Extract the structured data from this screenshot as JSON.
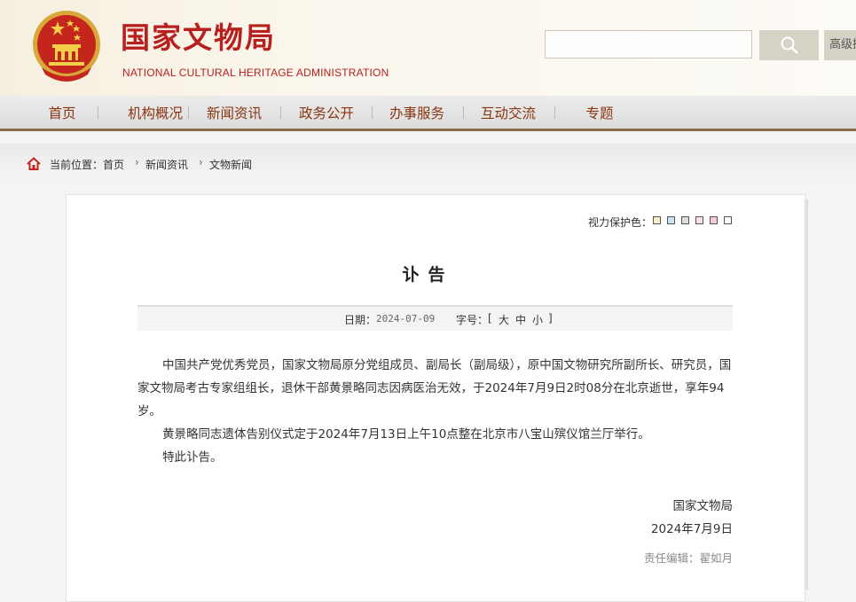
{
  "header": {
    "title": "国家文物局",
    "subtitle": "NATIONAL CULTURAL HERITAGE ADMINISTRATION",
    "search_placeholder": "",
    "advanced_label": "高级搜"
  },
  "nav": {
    "items": [
      "首页",
      "机构概况",
      "新闻资讯",
      "政务公开",
      "办事服务",
      "互动交流",
      "专题"
    ]
  },
  "breadcrumb": {
    "prefix": "当前位置：",
    "items": [
      "首页",
      "新闻资讯",
      "文物新闻"
    ]
  },
  "eye_protection": {
    "label": "视力保护色：",
    "colors": [
      "#f9f0c2",
      "#c5e6f1",
      "#dcdcdc",
      "#f8e2e2",
      "#f6c9d0",
      "#ffffff"
    ]
  },
  "article": {
    "title": "讣告",
    "date_label": "日期：",
    "date": "2024-07-09",
    "fontsize_label": "字号：",
    "fontsize_open": "[",
    "fontsize_large": "大",
    "fontsize_medium": "中",
    "fontsize_small": "小",
    "fontsize_close": "]",
    "paragraphs": [
      "中国共产党优秀党员，国家文物局原分党组成员、副局长（副局级），原中国文物研究所副所长、研究员，国家文物局考古专家组组长，退休干部黄景略同志因病医治无效，于2024年7月9日2时08分在北京逝世，享年94岁。",
      "黄景略同志遗体告别仪式定于2024年7月13日上午10点整在北京市八宝山殡仪馆兰厅举行。",
      "特此讣告。"
    ],
    "signature_org": "国家文物局",
    "signature_date": "2024年7月9日",
    "editor": "责任编辑：翟如月"
  },
  "colors": {
    "brand_red": "#b8201f",
    "nav_text": "#8a3410",
    "nav_border": "#8b6a44"
  }
}
